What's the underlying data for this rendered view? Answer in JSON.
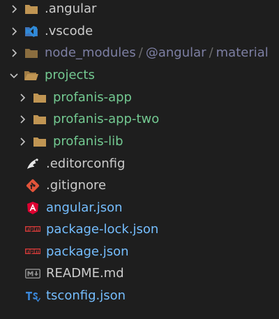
{
  "explorer": {
    "items": [
      {
        "label": ".angular",
        "kind": "folder",
        "expanded": false,
        "icon": "folder-icon"
      },
      {
        "label": ".vscode",
        "kind": "folder",
        "expanded": false,
        "icon": "vscode-folder-icon"
      },
      {
        "label_parts": [
          "node_modules",
          "@angular",
          "material"
        ],
        "separator": "/",
        "kind": "folder",
        "expanded": false,
        "icon": "folder-icon"
      },
      {
        "label": "projects",
        "kind": "folder",
        "expanded": true,
        "icon": "folder-open-icon"
      },
      {
        "label": "profanis-app",
        "kind": "folder",
        "expanded": false,
        "icon": "folder-icon"
      },
      {
        "label": "profanis-app-two",
        "kind": "folder",
        "expanded": false,
        "icon": "folder-icon"
      },
      {
        "label": "profanis-lib",
        "kind": "folder",
        "expanded": false,
        "icon": "folder-icon"
      },
      {
        "label": ".editorconfig",
        "kind": "file",
        "icon": "editorconfig-icon"
      },
      {
        "label": ".gitignore",
        "kind": "file",
        "icon": "git-icon"
      },
      {
        "label": "angular.json",
        "kind": "file",
        "icon": "angular-icon"
      },
      {
        "label": "package-lock.json",
        "kind": "file",
        "icon": "npm-icon"
      },
      {
        "label": "package.json",
        "kind": "file",
        "icon": "npm-icon"
      },
      {
        "label": "README.md",
        "kind": "file",
        "icon": "markdown-icon"
      },
      {
        "label": "tsconfig.json",
        "kind": "file",
        "icon": "typescript-icon"
      }
    ]
  },
  "colors": {
    "background": "#1e1e1e",
    "default_text": "#cccccc",
    "modified_green": "#73c991",
    "ignored_dim": "#7d7fa3",
    "json_blue": "#75beff",
    "folder": "#c09553",
    "angular_red": "#dd0031",
    "git_orange": "#e2543a",
    "npm_red": "#cb3837",
    "typescript_blue": "#3a87d9"
  }
}
